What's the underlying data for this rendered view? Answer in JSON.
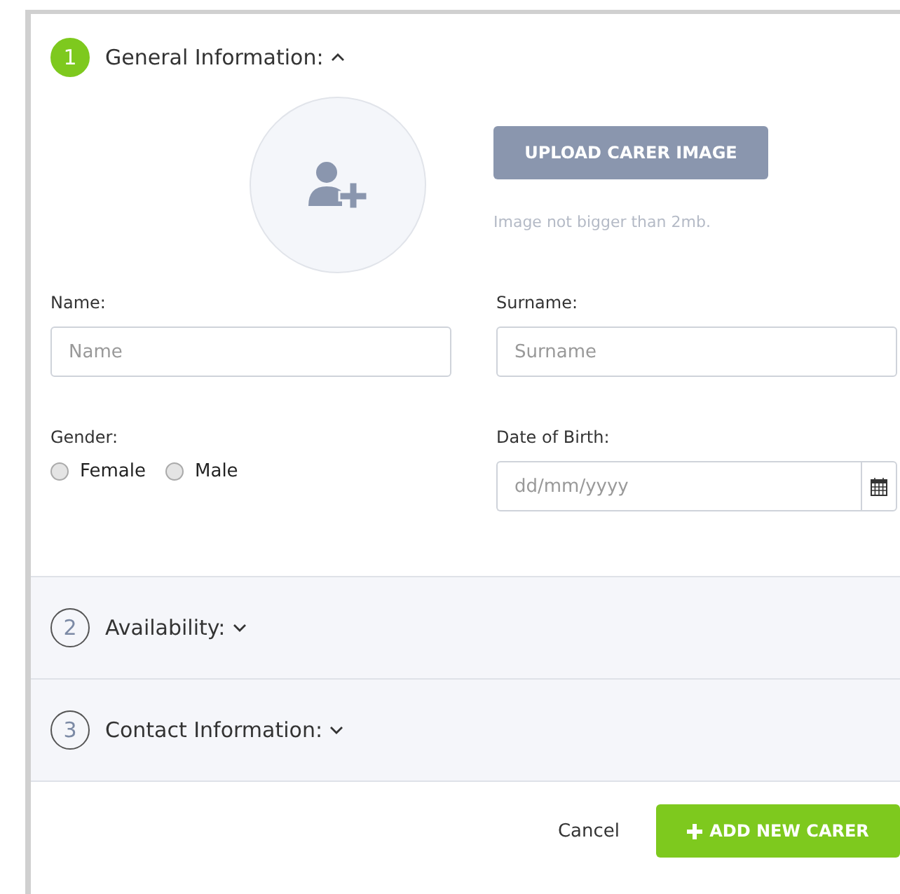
{
  "sections": [
    {
      "number": "1",
      "title": "General Information:",
      "expanded": true
    },
    {
      "number": "2",
      "title": "Availability:",
      "expanded": false
    },
    {
      "number": "3",
      "title": "Contact Information:",
      "expanded": false
    }
  ],
  "upload": {
    "button": "UPLOAD CARER IMAGE",
    "hint": "Image not bigger than 2mb."
  },
  "fields": {
    "name": {
      "label": "Name:",
      "placeholder": "Name"
    },
    "surname": {
      "label": "Surname:",
      "placeholder": "Surname"
    },
    "dob": {
      "label": "Date of Birth:",
      "placeholder": "dd/mm/yyyy"
    }
  },
  "gender": {
    "label": "Gender:",
    "options": [
      {
        "label": "Female",
        "selected": false
      },
      {
        "label": "Male",
        "selected": false
      }
    ]
  },
  "footer": {
    "cancel": "Cancel",
    "submit": "ADD NEW CARER"
  }
}
